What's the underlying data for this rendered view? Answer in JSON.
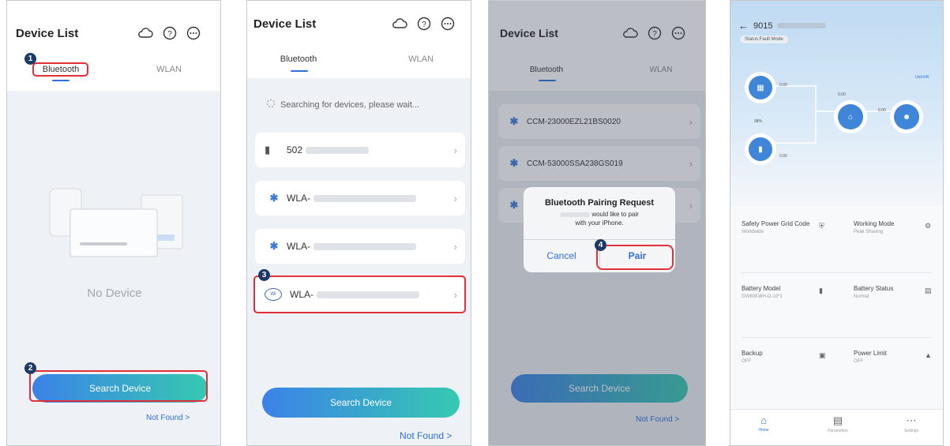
{
  "panel1": {
    "title": "Device List",
    "tabs": [
      "Bluetooth",
      "WLAN"
    ],
    "empty_text": "No Device",
    "search_button": "Search Device",
    "not_found": "Not Found >",
    "steps": [
      "1",
      "2"
    ]
  },
  "panel2": {
    "title": "Device List",
    "tabs": [
      "Bluetooth",
      "WLAN"
    ],
    "searching_text": "Searching for devices, please wait...",
    "devices": [
      "502",
      "WLA-",
      "WLA-",
      "WLA-"
    ],
    "search_button": "Search Device",
    "not_found": "Not Found >",
    "step": "3"
  },
  "panel3": {
    "title": "Device List",
    "tabs": [
      "Bluetooth",
      "WLAN"
    ],
    "devices": [
      "CCM-23000EZL21BS0020",
      "CCM-53000SSA238GS019"
    ],
    "dialog": {
      "title": "Bluetooth Pairing Request",
      "line1": "would like to pair",
      "line2": "with your iPhone.",
      "cancel": "Cancel",
      "pair": "Pair"
    },
    "search_button": "Search Device",
    "not_found": "Not Found >",
    "step": "4"
  },
  "panel4": {
    "serial": "9015",
    "status": "Status:Fault Mode",
    "unit": "Unit:kW",
    "values": {
      "pv": "0.00",
      "battery": "0.00",
      "grid": "0.00",
      "load": "0.00",
      "soc": "98%"
    },
    "cards": [
      {
        "label": "Safety Power Grid Code",
        "value": "Worldwide"
      },
      {
        "label": "Working Mode",
        "value": "Peak Shaving"
      },
      {
        "label": "Battery Model",
        "value": "GW80KWH-D-10*1"
      },
      {
        "label": "Battery Status",
        "value": "Normal"
      },
      {
        "label": "Backup",
        "value": "OFF"
      },
      {
        "label": "Power Limit",
        "value": "OFF"
      }
    ],
    "nav": [
      "Home",
      "Parameters",
      "Settings"
    ]
  }
}
